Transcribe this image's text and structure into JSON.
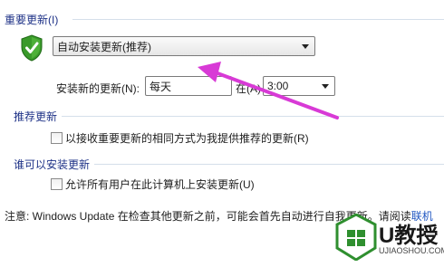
{
  "sections": {
    "important_updates": {
      "title": "重要更新(I)",
      "dropdown_value": "自动安装更新(推荐)",
      "install_label": "安装新的更新(N):",
      "day_value": "每天",
      "at_label": "在(A)",
      "time_value": "3:00"
    },
    "recommended_updates": {
      "title": "推荐更新",
      "checkbox_label": "以接收重要更新的相同方式为我提供推荐的更新(R)"
    },
    "who_can_install": {
      "title": "谁可以安装更新",
      "checkbox_label": "允许所有用户在此计算机上安装更新(U)"
    }
  },
  "note": {
    "text": "注意: Windows Update 在检查其他更新之前，可能会首先自动进行自我更新。请阅读",
    "link_text": "联机"
  },
  "watermark": {
    "brand": "U教授",
    "url": "UJIAOSHOU.COM"
  },
  "colors": {
    "section_title": "#1e3287",
    "annotation_arrow": "#d83ad6",
    "shield": "#3a9a2a",
    "watermark_green": "#2f8f2f"
  }
}
